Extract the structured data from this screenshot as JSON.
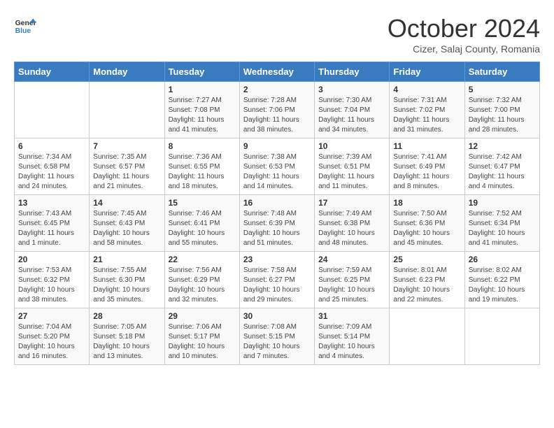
{
  "header": {
    "logo_line1": "General",
    "logo_line2": "Blue",
    "month": "October 2024",
    "location": "Cizer, Salaj County, Romania"
  },
  "days_of_week": [
    "Sunday",
    "Monday",
    "Tuesday",
    "Wednesday",
    "Thursday",
    "Friday",
    "Saturday"
  ],
  "weeks": [
    [
      {
        "day": "",
        "info": ""
      },
      {
        "day": "",
        "info": ""
      },
      {
        "day": "1",
        "info": "Sunrise: 7:27 AM\nSunset: 7:08 PM\nDaylight: 11 hours and 41 minutes."
      },
      {
        "day": "2",
        "info": "Sunrise: 7:28 AM\nSunset: 7:06 PM\nDaylight: 11 hours and 38 minutes."
      },
      {
        "day": "3",
        "info": "Sunrise: 7:30 AM\nSunset: 7:04 PM\nDaylight: 11 hours and 34 minutes."
      },
      {
        "day": "4",
        "info": "Sunrise: 7:31 AM\nSunset: 7:02 PM\nDaylight: 11 hours and 31 minutes."
      },
      {
        "day": "5",
        "info": "Sunrise: 7:32 AM\nSunset: 7:00 PM\nDaylight: 11 hours and 28 minutes."
      }
    ],
    [
      {
        "day": "6",
        "info": "Sunrise: 7:34 AM\nSunset: 6:58 PM\nDaylight: 11 hours and 24 minutes."
      },
      {
        "day": "7",
        "info": "Sunrise: 7:35 AM\nSunset: 6:57 PM\nDaylight: 11 hours and 21 minutes."
      },
      {
        "day": "8",
        "info": "Sunrise: 7:36 AM\nSunset: 6:55 PM\nDaylight: 11 hours and 18 minutes."
      },
      {
        "day": "9",
        "info": "Sunrise: 7:38 AM\nSunset: 6:53 PM\nDaylight: 11 hours and 14 minutes."
      },
      {
        "day": "10",
        "info": "Sunrise: 7:39 AM\nSunset: 6:51 PM\nDaylight: 11 hours and 11 minutes."
      },
      {
        "day": "11",
        "info": "Sunrise: 7:41 AM\nSunset: 6:49 PM\nDaylight: 11 hours and 8 minutes."
      },
      {
        "day": "12",
        "info": "Sunrise: 7:42 AM\nSunset: 6:47 PM\nDaylight: 11 hours and 4 minutes."
      }
    ],
    [
      {
        "day": "13",
        "info": "Sunrise: 7:43 AM\nSunset: 6:45 PM\nDaylight: 11 hours and 1 minute."
      },
      {
        "day": "14",
        "info": "Sunrise: 7:45 AM\nSunset: 6:43 PM\nDaylight: 10 hours and 58 minutes."
      },
      {
        "day": "15",
        "info": "Sunrise: 7:46 AM\nSunset: 6:41 PM\nDaylight: 10 hours and 55 minutes."
      },
      {
        "day": "16",
        "info": "Sunrise: 7:48 AM\nSunset: 6:39 PM\nDaylight: 10 hours and 51 minutes."
      },
      {
        "day": "17",
        "info": "Sunrise: 7:49 AM\nSunset: 6:38 PM\nDaylight: 10 hours and 48 minutes."
      },
      {
        "day": "18",
        "info": "Sunrise: 7:50 AM\nSunset: 6:36 PM\nDaylight: 10 hours and 45 minutes."
      },
      {
        "day": "19",
        "info": "Sunrise: 7:52 AM\nSunset: 6:34 PM\nDaylight: 10 hours and 41 minutes."
      }
    ],
    [
      {
        "day": "20",
        "info": "Sunrise: 7:53 AM\nSunset: 6:32 PM\nDaylight: 10 hours and 38 minutes."
      },
      {
        "day": "21",
        "info": "Sunrise: 7:55 AM\nSunset: 6:30 PM\nDaylight: 10 hours and 35 minutes."
      },
      {
        "day": "22",
        "info": "Sunrise: 7:56 AM\nSunset: 6:29 PM\nDaylight: 10 hours and 32 minutes."
      },
      {
        "day": "23",
        "info": "Sunrise: 7:58 AM\nSunset: 6:27 PM\nDaylight: 10 hours and 29 minutes."
      },
      {
        "day": "24",
        "info": "Sunrise: 7:59 AM\nSunset: 6:25 PM\nDaylight: 10 hours and 25 minutes."
      },
      {
        "day": "25",
        "info": "Sunrise: 8:01 AM\nSunset: 6:23 PM\nDaylight: 10 hours and 22 minutes."
      },
      {
        "day": "26",
        "info": "Sunrise: 8:02 AM\nSunset: 6:22 PM\nDaylight: 10 hours and 19 minutes."
      }
    ],
    [
      {
        "day": "27",
        "info": "Sunrise: 7:04 AM\nSunset: 5:20 PM\nDaylight: 10 hours and 16 minutes."
      },
      {
        "day": "28",
        "info": "Sunrise: 7:05 AM\nSunset: 5:18 PM\nDaylight: 10 hours and 13 minutes."
      },
      {
        "day": "29",
        "info": "Sunrise: 7:06 AM\nSunset: 5:17 PM\nDaylight: 10 hours and 10 minutes."
      },
      {
        "day": "30",
        "info": "Sunrise: 7:08 AM\nSunset: 5:15 PM\nDaylight: 10 hours and 7 minutes."
      },
      {
        "day": "31",
        "info": "Sunrise: 7:09 AM\nSunset: 5:14 PM\nDaylight: 10 hours and 4 minutes."
      },
      {
        "day": "",
        "info": ""
      },
      {
        "day": "",
        "info": ""
      }
    ]
  ]
}
